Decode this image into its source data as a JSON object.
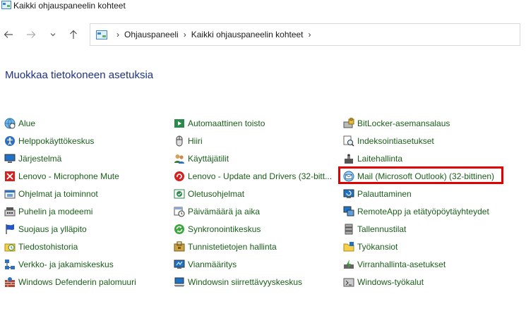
{
  "window": {
    "title": "Kaikki ohjauspaneelin kohteet"
  },
  "breadcrumb": [
    "Ohjauspaneeli",
    "Kaikki ohjauspaneelin kohteet"
  ],
  "heading": "Muokkaa tietokoneen asetuksia",
  "columns": [
    [
      {
        "label": "Alue",
        "icon": "globe-clock-icon"
      },
      {
        "label": "Helppokäyttökeskus",
        "icon": "accessibility-icon"
      },
      {
        "label": "Järjestelmä",
        "icon": "computer-icon"
      },
      {
        "label": "Lenovo - Microphone Mute",
        "icon": "microphone-mute-icon"
      },
      {
        "label": "Ohjelmat ja toiminnot",
        "icon": "programs-icon"
      },
      {
        "label": "Puhelin ja modeemi",
        "icon": "phone-modem-icon"
      },
      {
        "label": "Suojaus ja ylläpito",
        "icon": "flag-icon"
      },
      {
        "label": "Tiedostohistoria",
        "icon": "file-history-icon"
      },
      {
        "label": "Verkko- ja jakamiskeskus",
        "icon": "network-icon"
      },
      {
        "label": "Windows Defenderin palomuuri",
        "icon": "firewall-icon"
      }
    ],
    [
      {
        "label": "Automaattinen toisto",
        "icon": "autoplay-icon"
      },
      {
        "label": "Hiiri",
        "icon": "mouse-icon"
      },
      {
        "label": "Käyttäjätilit",
        "icon": "user-accounts-icon"
      },
      {
        "label": "Lenovo - Update and Drivers (32-bitt...",
        "icon": "lenovo-update-icon"
      },
      {
        "label": "Oletusohjelmat",
        "icon": "default-programs-icon"
      },
      {
        "label": "Päivämäärä ja aika",
        "icon": "date-time-icon"
      },
      {
        "label": "Synkronointikeskus",
        "icon": "sync-icon"
      },
      {
        "label": "Tunnistetietojen hallinta",
        "icon": "credential-icon"
      },
      {
        "label": "Vianmääritys",
        "icon": "troubleshooting-icon"
      },
      {
        "label": "Windowsin siirrettävyyskeskus",
        "icon": "mobility-center-icon"
      }
    ],
    [
      {
        "label": "BitLocker-asemansalaus",
        "icon": "bitlocker-icon"
      },
      {
        "label": "Indeksointiasetukset",
        "icon": "indexing-icon"
      },
      {
        "label": "Laitehallinta",
        "icon": "device-manager-icon"
      },
      {
        "label": "Mail (Microsoft Outlook) (32-bittinen)",
        "icon": "mail-icon"
      },
      {
        "label": "Palauttaminen",
        "icon": "recovery-icon"
      },
      {
        "label": "RemoteApp ja etätyöpöytäyhteydet",
        "icon": "remoteapp-icon"
      },
      {
        "label": "Tallennustilat",
        "icon": "storage-icon"
      },
      {
        "label": "Työkansiot",
        "icon": "work-folders-icon"
      },
      {
        "label": "Virranhallinta-asetukset",
        "icon": "power-options-icon"
      },
      {
        "label": "Windows-työkalut",
        "icon": "windows-tools-icon"
      }
    ]
  ]
}
